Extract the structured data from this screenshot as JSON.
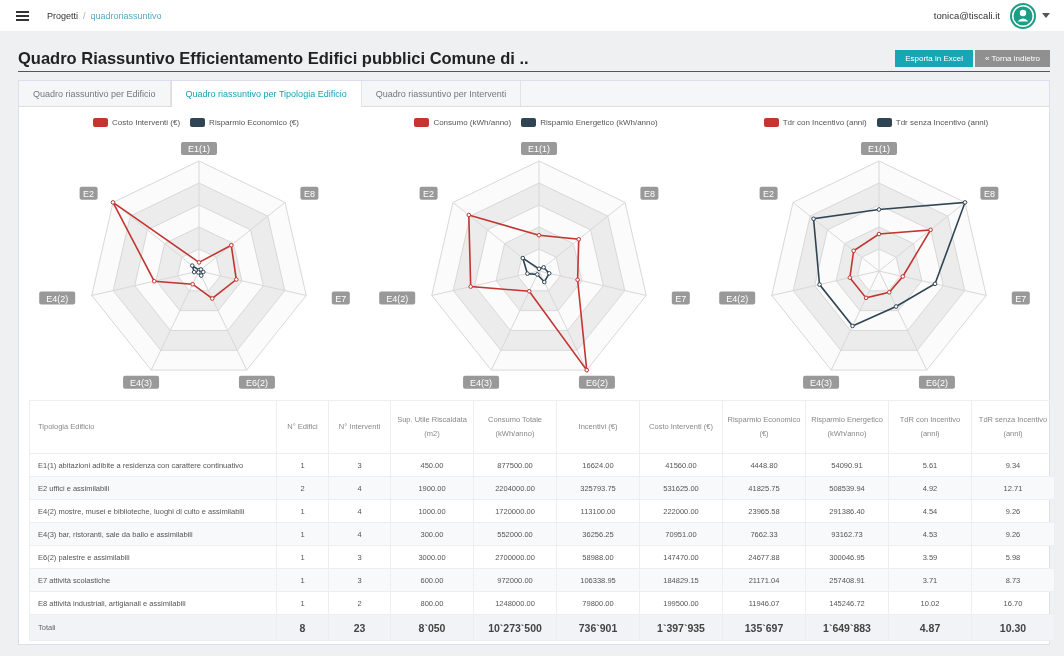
{
  "topbar": {
    "breadcrumb": [
      "Progetti",
      "quadroriassuntivo"
    ],
    "breadcrumb_separator": "/",
    "user": "tonica@tiscali.it"
  },
  "title": "Quadro Riassuntivo Efficientamento Edifici pubblici Comune di ..",
  "buttons": [
    {
      "label": "Esporta in Excel",
      "kind": "primary"
    },
    {
      "label": "« Torna indietro",
      "kind": "secondary"
    }
  ],
  "tabs": [
    {
      "label": "Quadro riassuntivo per Edificio",
      "selected": false
    },
    {
      "label": "Quadro riassuntivo per Tipologia Edificio",
      "selected": true
    },
    {
      "label": "Quadro riassuntivo per Interventi",
      "selected": false
    }
  ],
  "charts": [
    {
      "legend": [
        {
          "label": "Costo Interventi (€)",
          "color": "#c23531"
        },
        {
          "label": "Risparmio Economico (€)",
          "color": "#2f4554"
        }
      ],
      "axes": [
        "E1(1)",
        "E8",
        "E7",
        "E6(2)",
        "E4(3)",
        "E4(2)",
        "E2"
      ]
    },
    {
      "legend": [
        {
          "label": "Consumo (kWh/anno)",
          "color": "#c23531"
        },
        {
          "label": "Rispamio Energetico (kWh/anno)",
          "color": "#2f4554"
        }
      ],
      "axes": [
        "E1(1)",
        "E8",
        "E7",
        "E6(2)",
        "E4(3)",
        "E4(2)",
        "E2"
      ]
    },
    {
      "legend": [
        {
          "label": "Tdr con Incentivo (anni)",
          "color": "#c23531"
        },
        {
          "label": "Tdr senza Incentivo (anni)",
          "color": "#2f4554"
        }
      ],
      "axes": [
        "E1(1)",
        "E8",
        "E7",
        "E6(2)",
        "E4(3)",
        "E4(2)",
        "E2"
      ]
    }
  ],
  "table": {
    "columns": [
      "Tipologia Edificio",
      "N° Edifici",
      "N° Interventi",
      "Sup. Utile Riscaldata (m2)",
      "Consumo Totale (kWh/anno)",
      "Incentivi (€)",
      "Costo Interventi (€)",
      "Risparmio Economico (€)",
      "Risparmio Energetico (kWh/anno)",
      "TdR con Incentivo (anni)",
      "TdR senza Incentivo (anni)"
    ],
    "rows": [
      [
        "E1(1) abitazioni adibite a residenza con carattere continuativo",
        "1",
        "3",
        "450.00",
        "877500.00",
        "16624.00",
        "41560.00",
        "4448.80",
        "54090.91",
        "5.61",
        "9.34"
      ],
      [
        "E2 uffici e assimilabili",
        "2",
        "4",
        "1900.00",
        "2204000.00",
        "325793.75",
        "531625.00",
        "41825.75",
        "508539.94",
        "4.92",
        "12.71"
      ],
      [
        "E4(2) mostre, musei e biblioteche, luoghi di culto e assimilabili",
        "1",
        "4",
        "1000.00",
        "1720000.00",
        "113100.00",
        "222000.00",
        "23965.58",
        "291386.40",
        "4.54",
        "9.26"
      ],
      [
        "E4(3) bar, ristoranti, sale da ballo e assimilabili",
        "1",
        "4",
        "300.00",
        "552000.00",
        "36256.25",
        "70951.00",
        "7662.33",
        "93162.73",
        "4.53",
        "9.26"
      ],
      [
        "E6(2) palestre e assimilabili",
        "1",
        "3",
        "3000.00",
        "2700000.00",
        "58988.00",
        "147470.00",
        "24677.88",
        "300046.95",
        "3.59",
        "5.98"
      ],
      [
        "E7 attività scolastiche",
        "1",
        "3",
        "600.00",
        "972000.00",
        "106338.95",
        "184829.15",
        "21171.04",
        "257408.91",
        "3.71",
        "8.73"
      ],
      [
        "E8 attività industriali, artigianali e assimilabili",
        "1",
        "2",
        "800.00",
        "1248000.00",
        "79800.00",
        "199500.00",
        "11946.07",
        "145246.72",
        "10.02",
        "16.70"
      ]
    ],
    "totals": [
      "Totali",
      "8",
      "23",
      "8`050",
      "10`273`500",
      "736`901",
      "1`397`935",
      "135`697",
      "1`649`883",
      "4.87",
      "10.30"
    ]
  }
}
